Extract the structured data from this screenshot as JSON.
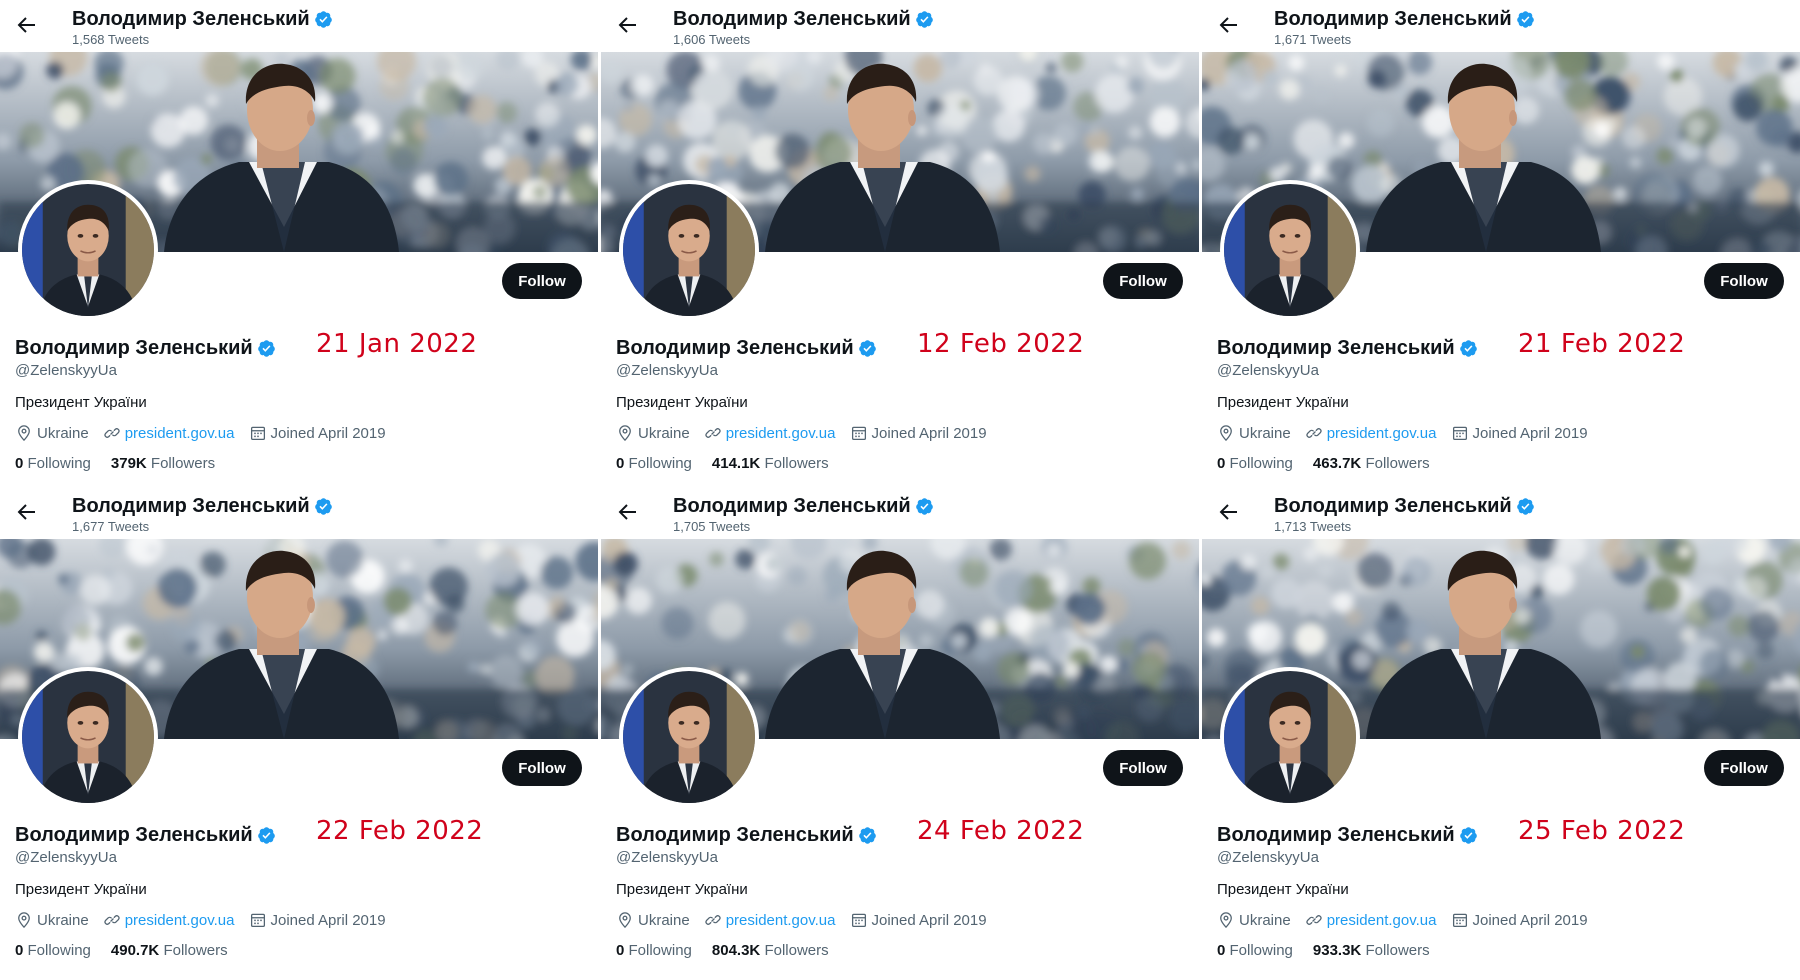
{
  "accent_color": "#1d9bf0",
  "date_color": "#d0021b",
  "panels": [
    {
      "top_name": "Володимир Зеленський",
      "tweet_count": "1,568 Tweets",
      "follow_label": "Follow",
      "profile_name": "Володимир Зеленський",
      "date": "21 Jan 2022",
      "handle": "@ZelenskyyUa",
      "bio": "Президент України",
      "location": "Ukraine",
      "website": "president.gov.ua",
      "joined": "Joined April 2019",
      "following_count": "0",
      "following_label": "Following",
      "followers_count": "379K",
      "followers_label": "Followers"
    },
    {
      "top_name": "Володимир Зеленський",
      "tweet_count": "1,606 Tweets",
      "follow_label": "Follow",
      "profile_name": "Володимир Зеленський",
      "date": "12 Feb 2022",
      "handle": "@ZelenskyyUa",
      "bio": "Президент України",
      "location": "Ukraine",
      "website": "president.gov.ua",
      "joined": "Joined April 2019",
      "following_count": "0",
      "following_label": "Following",
      "followers_count": "414.1K",
      "followers_label": "Followers"
    },
    {
      "top_name": "Володимир Зеленський",
      "tweet_count": "1,671 Tweets",
      "follow_label": "Follow",
      "profile_name": "Володимир Зеленський",
      "date": "21 Feb 2022",
      "handle": "@ZelenskyyUa",
      "bio": "Президент України",
      "location": "Ukraine",
      "website": "president.gov.ua",
      "joined": "Joined April 2019",
      "following_count": "0",
      "following_label": "Following",
      "followers_count": "463.7K",
      "followers_label": "Followers"
    },
    {
      "top_name": "Володимир Зеленський",
      "tweet_count": "1,677 Tweets",
      "follow_label": "Follow",
      "profile_name": "Володимир Зеленський",
      "date": "22 Feb 2022",
      "handle": "@ZelenskyyUa",
      "bio": "Президент України",
      "location": "Ukraine",
      "website": "president.gov.ua",
      "joined": "Joined April 2019",
      "following_count": "0",
      "following_label": "Following",
      "followers_count": "490.7K",
      "followers_label": "Followers"
    },
    {
      "top_name": "Володимир Зеленський",
      "tweet_count": "1,705 Tweets",
      "follow_label": "Follow",
      "profile_name": "Володимир Зеленський",
      "date": "24 Feb 2022",
      "handle": "@ZelenskyyUa",
      "bio": "Президент України",
      "location": "Ukraine",
      "website": "president.gov.ua",
      "joined": "Joined April 2019",
      "following_count": "0",
      "following_label": "Following",
      "followers_count": "804.3K",
      "followers_label": "Followers"
    },
    {
      "top_name": "Володимир Зеленський",
      "tweet_count": "1,713 Tweets",
      "follow_label": "Follow",
      "profile_name": "Володимир Зеленський",
      "date": "25 Feb 2022",
      "handle": "@ZelenskyyUa",
      "bio": "Президент України",
      "location": "Ukraine",
      "website": "president.gov.ua",
      "joined": "Joined April 2019",
      "following_count": "0",
      "following_label": "Following",
      "followers_count": "933.3K",
      "followers_label": "Followers"
    }
  ]
}
